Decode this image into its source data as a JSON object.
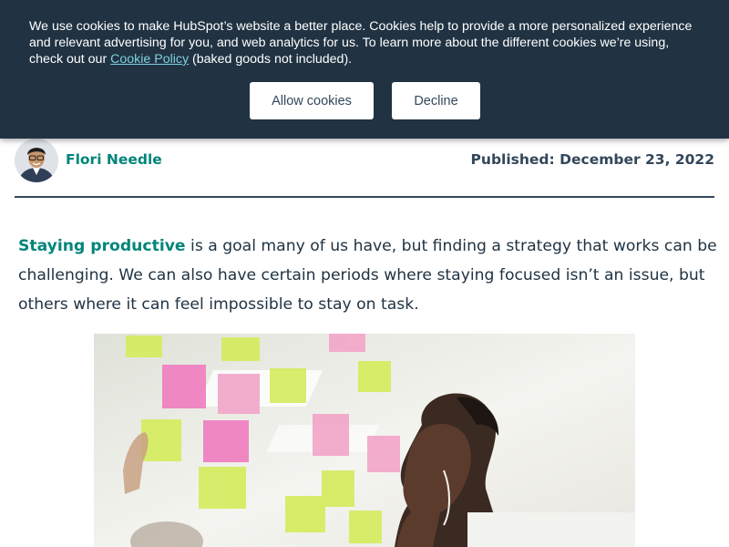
{
  "cookie_banner": {
    "text_before": "We use cookies to make HubSpot’s website a better place. Cookies help to provide a more personalized experience and relevant advertising for you, and web analytics for us. To learn more about the different cookies we’re using, check out our ",
    "policy_link": "Cookie Policy",
    "text_after": " (baked goods not included).",
    "allow_label": "Allow cookies",
    "decline_label": "Decline"
  },
  "author": {
    "name": "Flori Needle",
    "published": "Published: December 23, 2022"
  },
  "article": {
    "intro_link": "Staying productive",
    "intro_text": " is a goal many of us have, but finding a strategy that works can be challenging. We can also have certain periods where staying focused isn’t an issue, but others where it can feel impossible to stay on task."
  },
  "colors": {
    "banner_bg": "#213343",
    "link_teal": "#00857a",
    "text_dark": "#213343"
  }
}
